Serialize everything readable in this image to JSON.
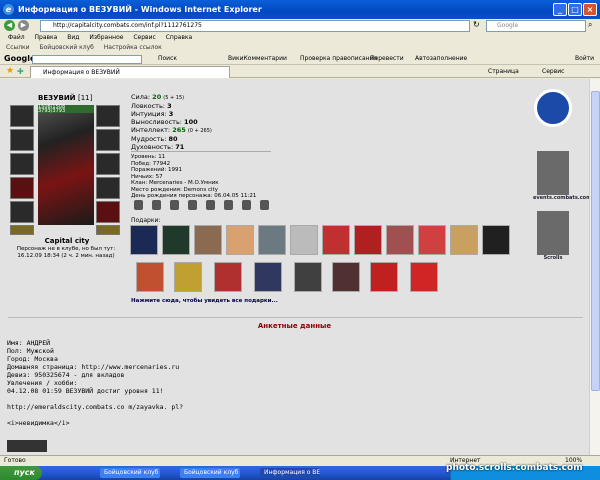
{
  "window": {
    "title": "Информация о ВЕЗУВИЙ - Windows Internet Explorer"
  },
  "address": {
    "url": "http://capitalcity.combats.com/inf.pl?1112761275",
    "search_placeholder": "Google"
  },
  "menu": [
    "Файл",
    "Правка",
    "Вид",
    "Избранное",
    "Сервис",
    "Справка"
  ],
  "links": [
    "Ссылки",
    "Бойцовский клуб",
    "Настройка ссылок"
  ],
  "google_bar": {
    "logo": "Google",
    "items": [
      "Поиск",
      "ВикиКомментарии",
      "Проверка правописания",
      "Перевести",
      "Автозаполнение",
      "Войти"
    ]
  },
  "tabs": {
    "active": "Информация о ВЕЗУВИЙ",
    "right": [
      "Страница",
      "Сервис"
    ]
  },
  "character": {
    "name": "ВЕЗУВИЙ",
    "level": "[11]",
    "hp": "1508/1508",
    "mana": "3793/3793",
    "city": "Capital city",
    "status_line1": "Персонаж не в клубе, но был тут:",
    "status_line2": "16.12.09 18:34 (2 ч. 2 мин. назад)"
  },
  "stats": [
    {
      "label": "Сила:",
      "value": "20",
      "extra": "(5 + 15)"
    },
    {
      "label": "Ловкость:",
      "value": "3",
      "extra": ""
    },
    {
      "label": "Интуиция:",
      "value": "3",
      "extra": ""
    },
    {
      "label": "Выносливость:",
      "value": "100",
      "extra": ""
    },
    {
      "label": "Интеллект:",
      "value": "265",
      "extra": "(0 + 265)"
    },
    {
      "label": "Мудрость:",
      "value": "80",
      "extra": ""
    },
    {
      "label": "Духовность:",
      "value": "71",
      "extra": ""
    }
  ],
  "info": [
    "Уровень: 11",
    "Побед: 77942",
    "Поражений: 1991",
    "Ничьих: 57",
    "Клан: Mercenaries - М.О.Умник",
    "Место рождения: Demons city",
    "День рождения персонажа: 06.04.05 11:21"
  ],
  "gifts": {
    "label": "Подарки:",
    "link": "Нажмите сюда, чтобы увидеть все подарки..."
  },
  "side": {
    "badge1": "events.combats.com",
    "badge2": "Scrolls"
  },
  "section_title": "Анкетные данные",
  "bio": [
    "Имя: АНДРЕЙ",
    "Пол: Мужской",
    "Город: Москва",
    "Домашняя страница: http://www.mercenaries.ru",
    "Девиз: 950325674 - для вкладов",
    "Увлечения / хобби:",
    "04.12.08 01:59 ВЕЗУВИЙ достиг уровня 11!",
    "",
    "http://emeraldscity.combats.co m/zayavka. pl?",
    "",
    "<i>невидимка</i>"
  ],
  "status": {
    "left": "Готово",
    "right": "Интернет",
    "zoom": "100%"
  },
  "taskbar": {
    "start": "пуск",
    "tasks": [
      "Бойцовский клуб -...",
      "Бойцовский клуб -...",
      "Информация о ВЕЗУ..."
    ]
  },
  "watermark": "photo.scrolls.combats.com"
}
